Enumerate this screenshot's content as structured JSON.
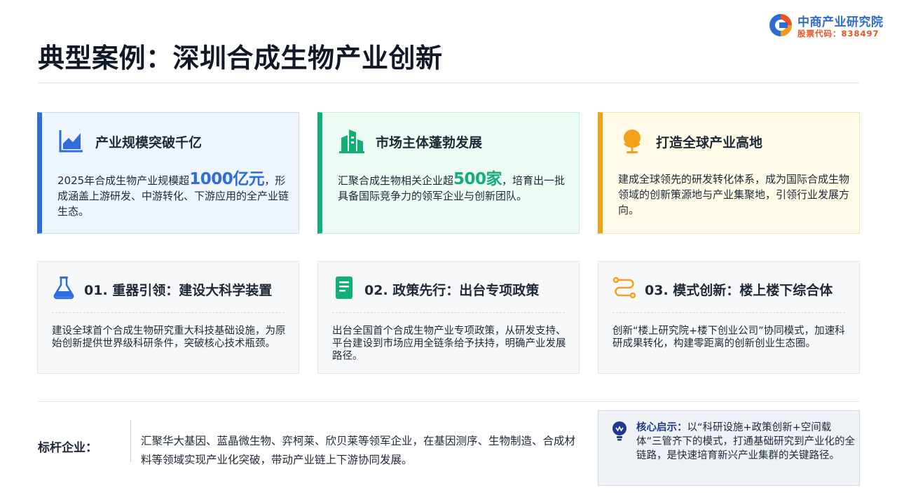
{
  "logo": {
    "name": "中商产业研究院",
    "code": "股票代码：838497",
    "colors": {
      "blue": "#2f6cd0",
      "orange": "#e8531f"
    }
  },
  "page": {
    "title": "典型案例：深圳合成生物产业创新"
  },
  "stats": [
    {
      "icon": "area-chart-icon",
      "accent": "#2f6cdf",
      "title": "产业规模突破千亿",
      "text_before": "2025年合成生物产业规模超",
      "highlight": "1000亿元",
      "text_after": "，形成涵盖上游研发、中游转化、下游应用的全产业链生态。"
    },
    {
      "icon": "buildings-icon",
      "accent": "#12b076",
      "title": "市场主体蓬勃发展",
      "text_before": "汇聚合成生物相关企业超",
      "highlight": "500家",
      "text_after": "，培育出一批具备国际竞争力的领军企业与创新团队。"
    },
    {
      "icon": "globe-icon",
      "accent": "#f3a218",
      "title": "打造全球产业高地",
      "text": "建成全球领先的研发转化体系，成为国际合成生物领域的创新策源地与产业集聚地，引领行业发展方向。"
    }
  ],
  "measures": [
    {
      "icon": "flask-icon",
      "title": "01. 重器引领：建设大科学装置",
      "text": "建设全球首个合成生物研究重大科技基础设施，为原始创新提供世界级科研条件，突破核心技术瓶颈。"
    },
    {
      "icon": "document-icon",
      "title": "02. 政策先行：出台专项政策",
      "text": "出台全国首个合成生物产业专项政策，从研发支持、平台建设到市场应用全链条给予扶持，明确产业发展路径。"
    },
    {
      "icon": "route-icon",
      "title": "03. 模式创新：楼上楼下综合体",
      "text": "创新“楼上研究院+楼下创业公司”协同模式，加速科研成果转化，构建零距离的创新创业生态圈。"
    }
  ],
  "benchmark": {
    "label": "标杆企业：",
    "text": "汇聚华大基因、蓝晶微生物、弈柯莱、欣贝莱等领军企业，在基因测序、生物制造、合成材料等领域实现产业化突破，带动产业链上下游协同发展。"
  },
  "insight": {
    "icon": "lightbulb-icon",
    "label": "核心启示：",
    "text": "以“科研设施+政策创新+空间载体”三管齐下的模式，打通基础研究到产业化的全链路，是快速培育新兴产业集群的关键路径。"
  }
}
